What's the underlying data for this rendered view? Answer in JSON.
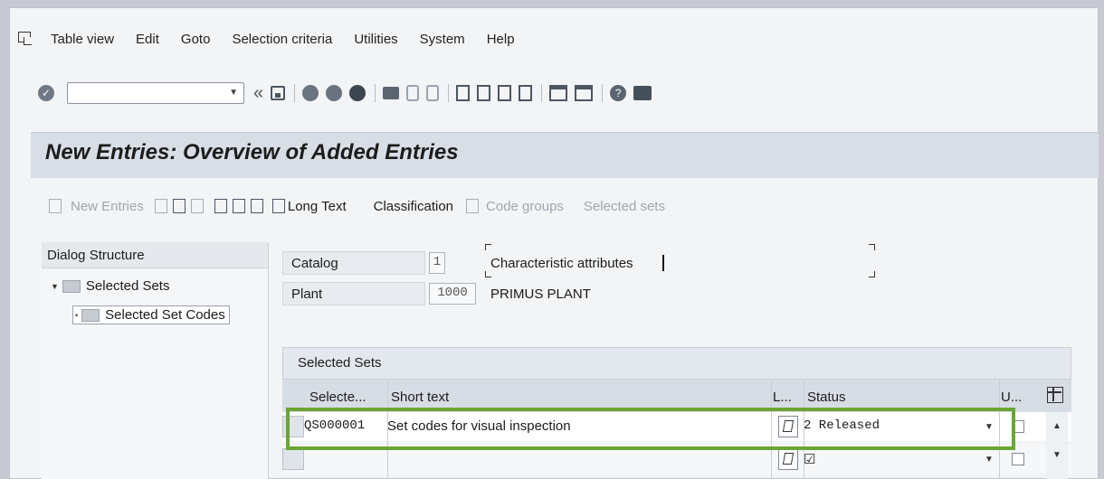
{
  "menu": [
    "Table view",
    "Edit",
    "Goto",
    "Selection criteria",
    "Utilities",
    "System",
    "Help"
  ],
  "toolbar": {
    "back_symbol": "«"
  },
  "page_title": "New Entries: Overview of Added Entries",
  "app_toolbar": {
    "new_entries": "New Entries",
    "long_text": "Long Text",
    "classification": "Classification",
    "code_groups": "Code groups",
    "selected_sets": "Selected sets"
  },
  "dialog": {
    "heading": "Dialog Structure",
    "node1": "Selected Sets",
    "node2": "Selected Set Codes"
  },
  "fields": {
    "catalog_label": "Catalog",
    "catalog_value": "1",
    "catalog_text": "Characteristic attributes",
    "plant_label": "Plant",
    "plant_value": "1000",
    "plant_text": "PRIMUS PLANT"
  },
  "table": {
    "title": "Selected Sets",
    "columns": {
      "selected": "Selecte...",
      "short_text": "Short text",
      "l": "L...",
      "status": "Status",
      "u": "U..."
    },
    "rows": [
      {
        "selected_set": "QS000001",
        "short_text": "Set codes for visual inspection",
        "status": "2 Released"
      },
      {
        "selected_set": "",
        "short_text": "",
        "status": "☑"
      }
    ]
  }
}
